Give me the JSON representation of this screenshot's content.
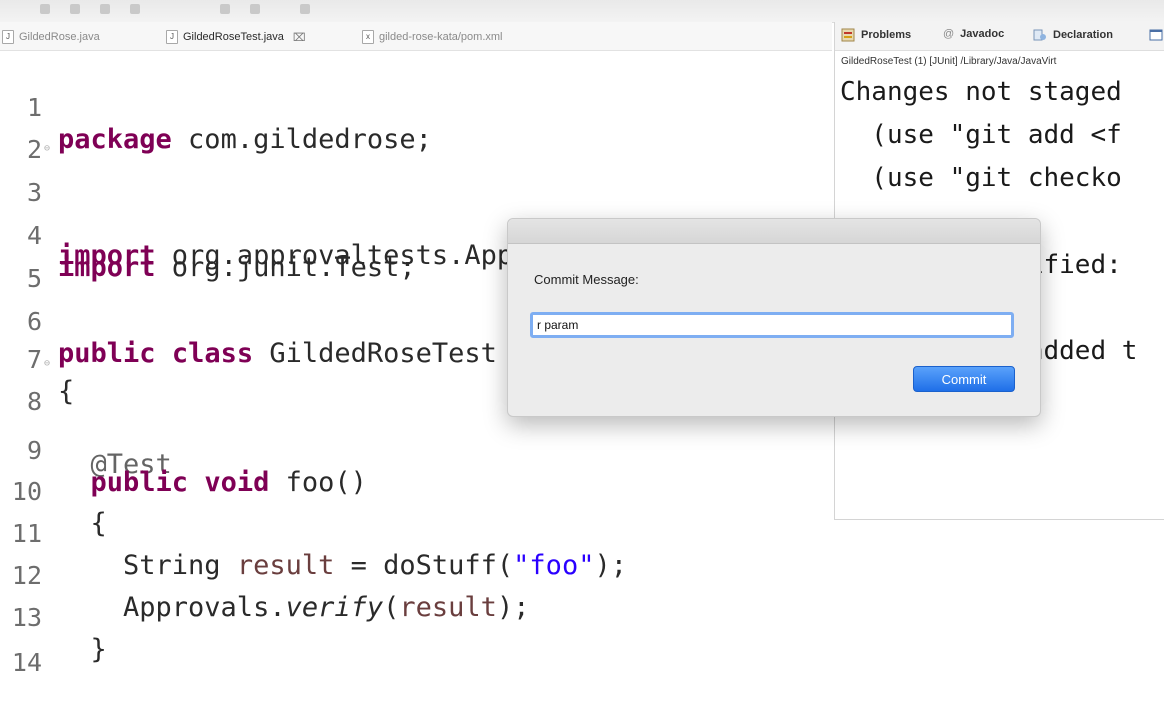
{
  "editor": {
    "tabs": [
      {
        "label": "GildedRose.java",
        "icon": "java-file-icon"
      },
      {
        "label": "GildedRoseTest.java",
        "icon": "java-file-icon",
        "active": true
      },
      {
        "label": "gilded-rose-kata/pom.xml",
        "icon": "xml-file-icon"
      }
    ],
    "line_numbers": [
      "1",
      "2",
      "3",
      "4",
      "5",
      "6",
      "7",
      "8",
      "9",
      "10",
      "11",
      "12",
      "13",
      "14"
    ]
  },
  "side_view": {
    "tabs": [
      "Problems",
      "Javadoc",
      "Declaration"
    ],
    "launch_path": "GildedRoseTest (1) [JUnit] /Library/Java/JavaVirt",
    "console_lines": [
      "Changes not staged",
      "  (use \"git add <f",
      "  (use \"git checko",
      "",
      "            ified:",
      "",
      "            added t"
    ]
  },
  "dialog": {
    "label": "Commit Message:",
    "input_value": "r param",
    "button_label": "Commit"
  },
  "colors": {
    "keyword": "#7f0055",
    "string": "#2a00ff",
    "commit_button": "#2f7ff0",
    "input_focus": "#7eaef2"
  }
}
